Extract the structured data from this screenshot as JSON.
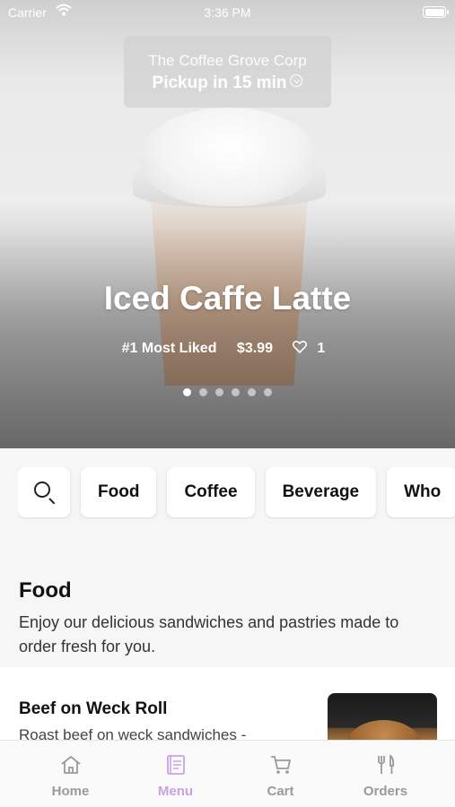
{
  "status_bar": {
    "carrier": "Carrier",
    "time": "3:36 PM"
  },
  "pickup": {
    "store": "The Coffee Grove Corp",
    "label": "Pickup in 15 min"
  },
  "hero": {
    "title": "Iced Caffe Latte",
    "rank": "#1 Most Liked",
    "price": "$3.99",
    "likes": "1",
    "page_count": 6,
    "active_page": 0
  },
  "categories": {
    "search_icon": "search-icon",
    "items": [
      "Food",
      "Coffee",
      "Beverage",
      "Who"
    ]
  },
  "section": {
    "title": "Food",
    "description": "Enjoy our delicious sandwiches and pastries made to order fresh for you."
  },
  "item": {
    "name": "Beef on Weck Roll",
    "description": "Roast beef on weck sandwiches -"
  },
  "tabbar": {
    "active_color": "#c8a3e3",
    "tabs": [
      {
        "label": "Home",
        "icon": "home-icon"
      },
      {
        "label": "Menu",
        "icon": "menu-icon"
      },
      {
        "label": "Cart",
        "icon": "cart-icon"
      },
      {
        "label": "Orders",
        "icon": "orders-icon"
      }
    ]
  }
}
